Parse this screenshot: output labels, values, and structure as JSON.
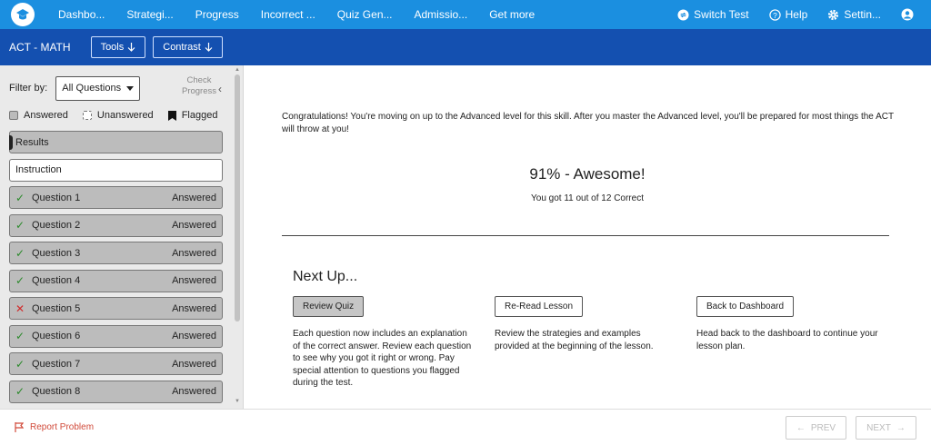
{
  "topnav": {
    "items": [
      "Dashbo...",
      "Strategi...",
      "Progress",
      "Incorrect ...",
      "Quiz Gen...",
      "Admissio...",
      "Get more"
    ],
    "right": {
      "switch": "Switch Test",
      "help": "Help",
      "settings": "Settin..."
    }
  },
  "subbar": {
    "title": "ACT - MATH",
    "tools": "Tools",
    "contrast": "Contrast"
  },
  "sidebar": {
    "filter_label": "Filter by:",
    "filter_value": "All Questions",
    "check_progress": "Check Progress",
    "legend": {
      "answered": "Answered",
      "unanswered": "Unanswered",
      "flagged": "Flagged"
    },
    "items": [
      {
        "label": "Results",
        "status": "",
        "mark": ""
      },
      {
        "label": "Instruction",
        "status": "",
        "mark": ""
      },
      {
        "label": "Question 1",
        "status": "Answered",
        "mark": "✓"
      },
      {
        "label": "Question 2",
        "status": "Answered",
        "mark": "✓"
      },
      {
        "label": "Question 3",
        "status": "Answered",
        "mark": "✓"
      },
      {
        "label": "Question 4",
        "status": "Answered",
        "mark": "✓"
      },
      {
        "label": "Question 5",
        "status": "Answered",
        "mark": "✕"
      },
      {
        "label": "Question 6",
        "status": "Answered",
        "mark": "✓"
      },
      {
        "label": "Question 7",
        "status": "Answered",
        "mark": "✓"
      },
      {
        "label": "Question 8",
        "status": "Answered",
        "mark": "✓"
      }
    ]
  },
  "main": {
    "message": "Congratulations! You're moving on up to the Advanced level for this skill. After you master the Advanced level, you'll be prepared for most things the ACT will throw at you!",
    "score": "91% - Awesome!",
    "score_sub": "You got 11 out of 12 Correct",
    "next_up": "Next Up...",
    "options": [
      {
        "button": "Review Quiz",
        "desc": "Each question now includes an explanation of the correct answer. Review each question to see why you got it right or wrong. Pay special attention to questions you flagged during the test."
      },
      {
        "button": "Re-Read Lesson",
        "desc": "Review the strategies and examples provided at the beginning of the lesson."
      },
      {
        "button": "Back to Dashboard",
        "desc": "Head back to the dashboard to continue your lesson plan."
      }
    ]
  },
  "footer": {
    "report": "Report Problem",
    "prev": "PREV",
    "next": "NEXT"
  },
  "colors": {
    "topnav": "#1b8fe0",
    "subbar": "#1450b0",
    "check": "#2b8a2b",
    "cross": "#d12a2a",
    "report": "#d14a3a"
  }
}
